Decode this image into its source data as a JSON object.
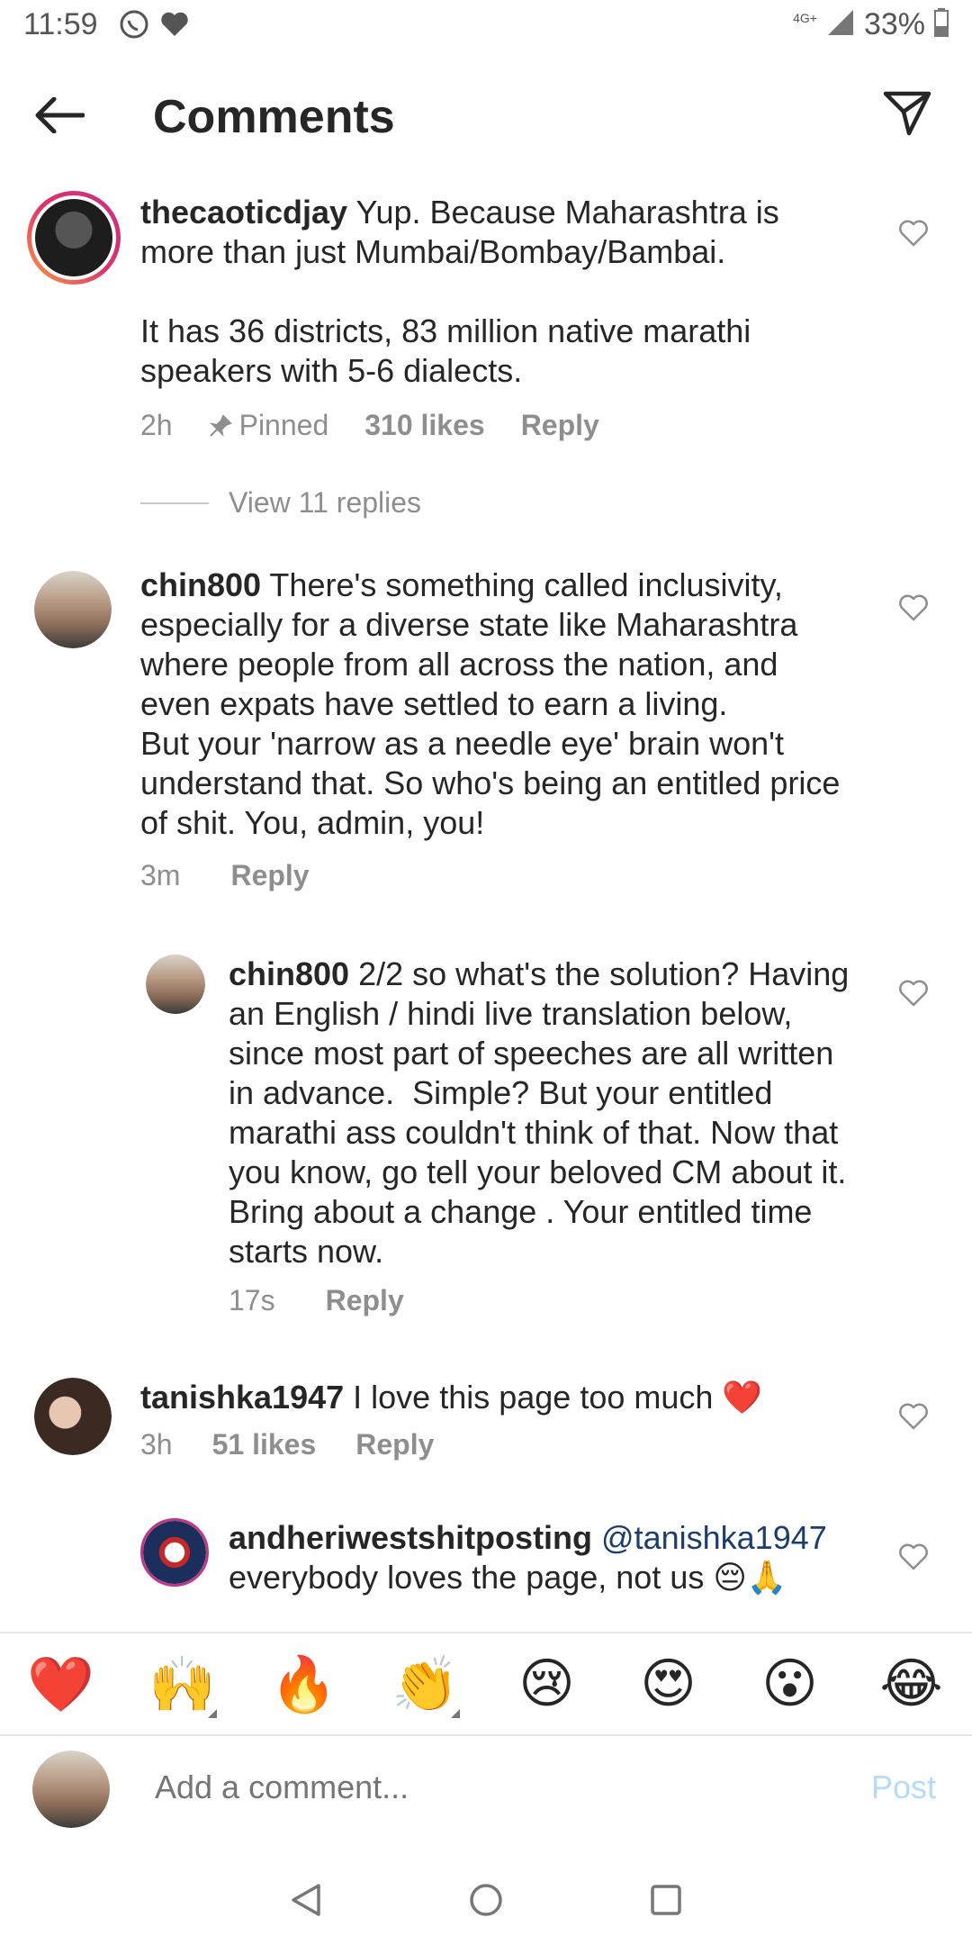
{
  "status_bar": {
    "time": "11:59",
    "network": "4G+",
    "battery": "33%"
  },
  "header": {
    "title": "Comments"
  },
  "comments": [
    {
      "username": "thecaoticdjay",
      "text": " Yup. Because Maharashtra is more than just Mumbai/Bombay/Bambai.\n\nIt has 36 districts, 83 million native marathi speakers with 5-6 dialects.",
      "time": "2h",
      "pinned": "Pinned",
      "likes": "310 likes",
      "reply": "Reply",
      "view_replies": "View 11 replies"
    },
    {
      "username": "chin800",
      "text": " There's something called inclusivity, especially for a diverse state like Maharashtra where people from all across the nation, and even expats have settled to earn a living.\nBut your 'narrow as a needle eye' brain won't understand that. So who's being an entitled price of shit. You, admin, you!",
      "time": "3m",
      "reply": "Reply"
    },
    {
      "username": "chin800",
      "text": " 2/2 so what's the solution? Having an English / hindi live translation below, since most part of speeches are all written in advance.  Simple? But your entitled marathi ass couldn't think of that. Now that you know, go tell your beloved CM about it. Bring about a change . Your entitled time starts now.",
      "time": "17s",
      "reply": "Reply"
    },
    {
      "username": "tanishka1947",
      "text": " I love this page too much ❤️",
      "time": "3h",
      "likes": "51 likes",
      "reply": "Reply"
    },
    {
      "username": "andheriwestshitposting",
      "mention": " @tanishka1947",
      "text": "everybody loves the page, not us 😔🙏"
    }
  ],
  "emoji_bar": [
    "❤️",
    "🙌",
    "🔥",
    "👏",
    "😢",
    "😍",
    "😮",
    "😂"
  ],
  "add_comment": {
    "placeholder": "Add a comment...",
    "post_label": "Post"
  },
  "colors": {
    "text": "#262626",
    "secondary": "#8e8e8e",
    "post_disabled": "#b3dbff",
    "mention": "#1c3e6e"
  }
}
